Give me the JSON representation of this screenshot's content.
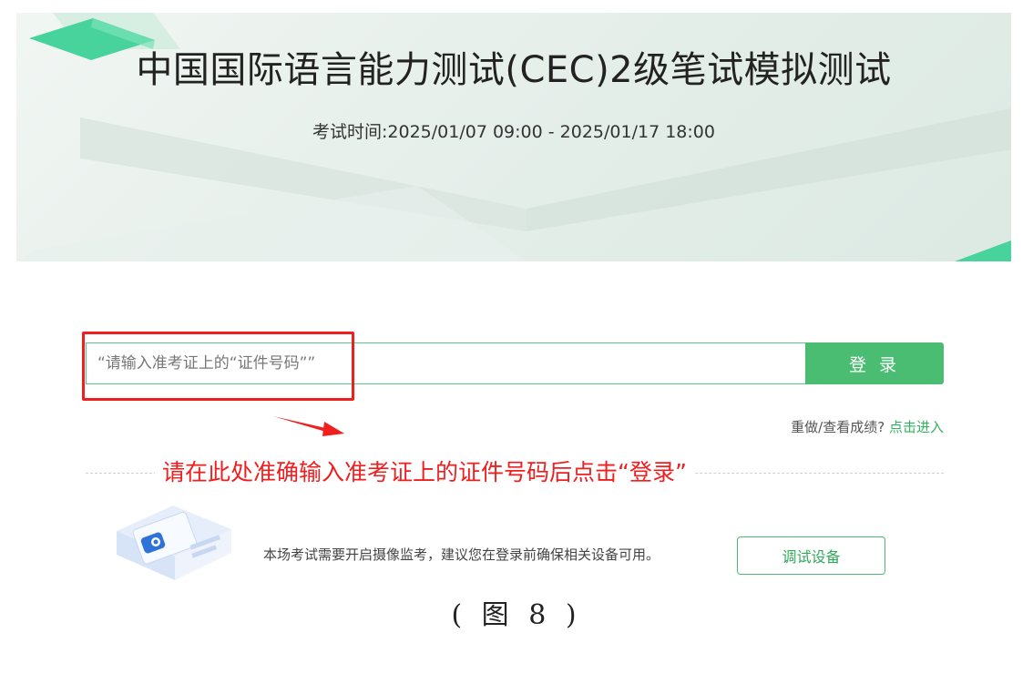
{
  "banner": {
    "title": "中国国际语言能力测试(CEC)2级笔试模拟测试",
    "exam_time": "考试时间:2025/01/07 09:00 - 2025/01/17 18:00"
  },
  "login": {
    "placeholder": "“请输入准考证上的“证件号码””",
    "button_label": "登 录"
  },
  "redo": {
    "prefix": "重做/查看成绩?",
    "link_label": "点击进入"
  },
  "annotation": {
    "text": "请在此处准确输入准考证上的证件号码后点击“登录”"
  },
  "device": {
    "notice": "本场考试需要开启摄像监考，建议您在登录前确保相关设备可用。",
    "button_label": "调试设备"
  },
  "figure_caption": "( 图 8 )",
  "colors": {
    "accent": "#4bbd72",
    "annotation_red": "#f01e1e"
  }
}
